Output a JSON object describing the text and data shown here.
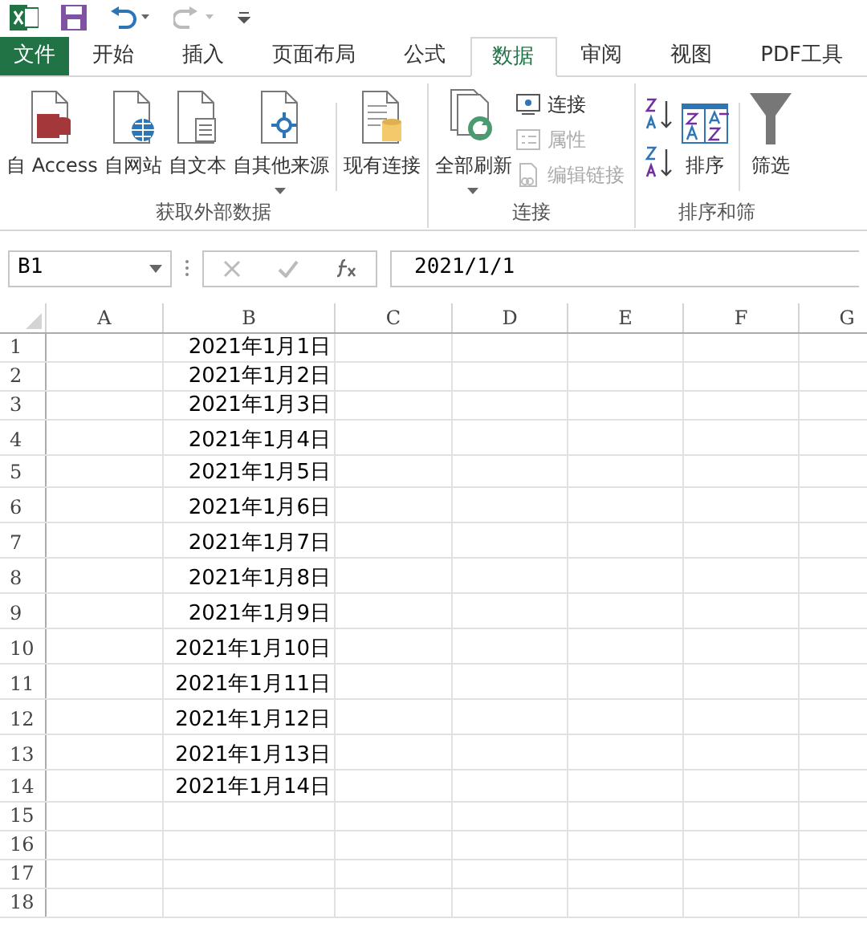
{
  "tabs": [
    {
      "label": "文件",
      "kind": "file",
      "selected": false
    },
    {
      "label": "开始",
      "kind": "tab",
      "selected": false
    },
    {
      "label": "插入",
      "kind": "tab",
      "selected": false
    },
    {
      "label": "页面布局",
      "kind": "tab",
      "selected": false
    },
    {
      "label": "公式",
      "kind": "tab",
      "selected": false
    },
    {
      "label": "数据",
      "kind": "tab",
      "selected": true
    },
    {
      "label": "审阅",
      "kind": "tab",
      "selected": false
    },
    {
      "label": "视图",
      "kind": "tab",
      "selected": false
    },
    {
      "label": "PDF工具",
      "kind": "tab",
      "selected": false
    }
  ],
  "ribbon": {
    "groups": [
      {
        "label": "获取外部数据",
        "items": [
          {
            "label": "自 Access",
            "kind": "large",
            "dropdown": false
          },
          {
            "label": "自网站",
            "kind": "large",
            "dropdown": false
          },
          {
            "label": "自文本",
            "kind": "large",
            "dropdown": false
          },
          {
            "label": "自其他来源",
            "kind": "large",
            "dropdown": true
          },
          {
            "label": "现有连接",
            "kind": "large",
            "dropdown": false
          }
        ]
      },
      {
        "label": "连接",
        "items": [
          {
            "label": "全部刷新",
            "kind": "large",
            "dropdown": true
          },
          {
            "label": "连接",
            "kind": "small",
            "disabled": false
          },
          {
            "label": "属性",
            "kind": "small",
            "disabled": true
          },
          {
            "label": "编辑链接",
            "kind": "small",
            "disabled": true
          }
        ]
      },
      {
        "label": "排序和筛",
        "items": [
          {
            "kind": "sort-pair"
          },
          {
            "label": "排序",
            "kind": "large",
            "dropdown": false
          },
          {
            "label": "筛选",
            "kind": "large",
            "dropdown": false
          }
        ]
      }
    ]
  },
  "formula_bar": {
    "name_box": "B1",
    "formula": "2021/1/1"
  },
  "grid": {
    "columns": [
      "A",
      "B",
      "C",
      "D",
      "E",
      "F",
      "G"
    ],
    "rows": [
      {
        "label": "1",
        "B": "2021年1月1日"
      },
      {
        "label": "2",
        "B": "2021年1月2日"
      },
      {
        "label": "3",
        "B": "2021年1月3日"
      },
      {
        "label": "4",
        "B": "2021年1月4日"
      },
      {
        "label": "5",
        "B": "2021年1月5日"
      },
      {
        "label": "6",
        "B": "2021年1月6日"
      },
      {
        "label": "7",
        "B": "2021年1月7日"
      },
      {
        "label": "8",
        "B": "2021年1月8日"
      },
      {
        "label": "9",
        "B": "2021年1月9日"
      },
      {
        "label": "10",
        "B": "2021年1月10日"
      },
      {
        "label": "11",
        "B": "2021年1月11日"
      },
      {
        "label": "12",
        "B": "2021年1月12日"
      },
      {
        "label": "13",
        "B": "2021年1月13日"
      },
      {
        "label": "14",
        "B": "2021年1月14日"
      },
      {
        "label": "15"
      },
      {
        "label": "16"
      },
      {
        "label": "17"
      },
      {
        "label": "18"
      }
    ]
  }
}
